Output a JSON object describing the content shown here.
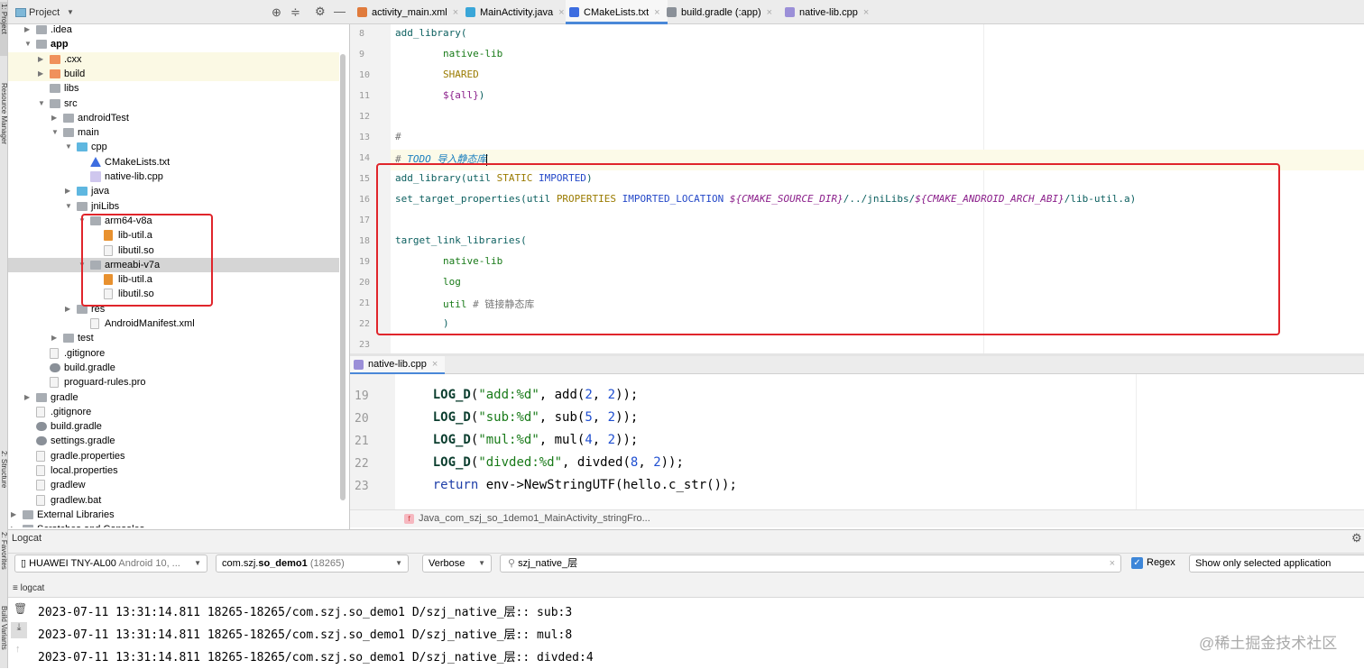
{
  "side_strip": {
    "top_label": "1: Project",
    "mid_label": "Resource Manager",
    "low_label": "2: Structure",
    "fav_label": "2: Favorites",
    "bottom_label": "Build Variants"
  },
  "project": {
    "title": "Project",
    "tree": [
      {
        "label": ".idea",
        "level": 0,
        "arrow": "closed",
        "icon": "folder"
      },
      {
        "label": "app",
        "level": 0,
        "arrow": "open",
        "icon": "folder",
        "bold": true
      },
      {
        "label": ".cxx",
        "level": 1,
        "arrow": "closed",
        "icon": "orange",
        "hl": true
      },
      {
        "label": "build",
        "level": 1,
        "arrow": "closed",
        "icon": "orange",
        "hl": true
      },
      {
        "label": "libs",
        "level": 1,
        "arrow": "",
        "icon": "folder"
      },
      {
        "label": "src",
        "level": 1,
        "arrow": "open",
        "icon": "folder"
      },
      {
        "label": "androidTest",
        "level": 2,
        "arrow": "closed",
        "icon": "folder"
      },
      {
        "label": "main",
        "level": 2,
        "arrow": "open",
        "icon": "folder"
      },
      {
        "label": "cpp",
        "level": 3,
        "arrow": "open",
        "icon": "blue"
      },
      {
        "label": "CMakeLists.txt",
        "level": 4,
        "arrow": "",
        "icon": "cmake"
      },
      {
        "label": "native-lib.cpp",
        "level": 4,
        "arrow": "",
        "icon": "cpp"
      },
      {
        "label": "java",
        "level": 3,
        "arrow": "closed",
        "icon": "blue"
      },
      {
        "label": "jniLibs",
        "level": 3,
        "arrow": "open",
        "icon": "folder"
      },
      {
        "label": "arm64-v8a",
        "level": 4,
        "arrow": "open",
        "icon": "folder"
      },
      {
        "label": "lib-util.a",
        "level": 5,
        "arrow": "",
        "icon": "archive"
      },
      {
        "label": "libutil.so",
        "level": 5,
        "arrow": "",
        "icon": "file"
      },
      {
        "label": "armeabi-v7a",
        "level": 4,
        "arrow": "open",
        "icon": "folder",
        "selected": true
      },
      {
        "label": "lib-util.a",
        "level": 5,
        "arrow": "",
        "icon": "archive"
      },
      {
        "label": "libutil.so",
        "level": 5,
        "arrow": "",
        "icon": "file"
      },
      {
        "label": "res",
        "level": 3,
        "arrow": "closed",
        "icon": "folder"
      },
      {
        "label": "AndroidManifest.xml",
        "level": 4,
        "arrow": "",
        "icon": "file"
      },
      {
        "label": "test",
        "level": 2,
        "arrow": "closed",
        "icon": "folder"
      },
      {
        "label": ".gitignore",
        "level": 1,
        "arrow": "",
        "icon": "file"
      },
      {
        "label": "build.gradle",
        "level": 1,
        "arrow": "",
        "icon": "gradle"
      },
      {
        "label": "proguard-rules.pro",
        "level": 1,
        "arrow": "",
        "icon": "file"
      },
      {
        "label": "gradle",
        "level": 0,
        "arrow": "closed",
        "icon": "folder"
      },
      {
        "label": ".gitignore",
        "level": 0,
        "arrow": "",
        "icon": "file"
      },
      {
        "label": "build.gradle",
        "level": 0,
        "arrow": "",
        "icon": "gradle"
      },
      {
        "label": "settings.gradle",
        "level": 0,
        "arrow": "",
        "icon": "gradle"
      },
      {
        "label": "gradle.properties",
        "level": 0,
        "arrow": "",
        "icon": "file"
      },
      {
        "label": "local.properties",
        "level": 0,
        "arrow": "",
        "icon": "file"
      },
      {
        "label": "gradlew",
        "level": 0,
        "arrow": "",
        "icon": "file"
      },
      {
        "label": "gradlew.bat",
        "level": 0,
        "arrow": "",
        "icon": "file"
      },
      {
        "label": "External Libraries",
        "level": -1,
        "arrow": "closed",
        "icon": "folder"
      },
      {
        "label": "Scratches and Consoles",
        "level": -1,
        "arrow": "closed",
        "icon": "folder"
      }
    ]
  },
  "editor_tabs": [
    {
      "label": "activity_main.xml",
      "color": "#e07b3c"
    },
    {
      "label": "MainActivity.java",
      "color": "#3aa6d8"
    },
    {
      "label": "CMakeLists.txt",
      "color": "#3d6de0",
      "active": true
    },
    {
      "label": "build.gradle (:app)",
      "color": "#8a9098"
    },
    {
      "label": "native-lib.cpp",
      "color": "#9b8fd8"
    }
  ],
  "cmake_lines": [
    {
      "n": "8",
      "t": [
        [
          "add_library(",
          "kw"
        ]
      ]
    },
    {
      "n": "9",
      "t": [
        [
          "        native-lib",
          "str"
        ]
      ]
    },
    {
      "n": "10",
      "t": [
        [
          "        SHARED",
          "con"
        ]
      ]
    },
    {
      "n": "11",
      "t": [
        [
          "        ${all}",
          "var"
        ],
        [
          ")",
          "kw"
        ]
      ]
    },
    {
      "n": "12",
      "t": []
    },
    {
      "n": "13",
      "t": [
        [
          "#",
          "cm"
        ]
      ]
    },
    {
      "n": "14",
      "t": [
        [
          "# ",
          "cm"
        ],
        [
          "TODO 导入静态库",
          "todo"
        ]
      ],
      "cur": true
    },
    {
      "n": "15",
      "t": [
        [
          "add_library(util ",
          "kw"
        ],
        [
          "STATIC ",
          "con"
        ],
        [
          "IMPORTED",
          "prop"
        ],
        [
          ")",
          "kw"
        ]
      ]
    },
    {
      "n": "16",
      "t": [
        [
          "set_target_properties(util ",
          "kw"
        ],
        [
          "PROPERTIES ",
          "con"
        ],
        [
          "IMPORTED_LOCATION ",
          "prop"
        ],
        [
          "${CMAKE_SOURCE_DIR}",
          "it"
        ],
        [
          "/../jniLibs/",
          "kw"
        ],
        [
          "${CMAKE_ANDROID_ARCH_ABI}",
          "it"
        ],
        [
          "/lib-util.a)",
          "kw"
        ]
      ]
    },
    {
      "n": "17",
      "t": []
    },
    {
      "n": "18",
      "t": [
        [
          "target_link_libraries(",
          "kw"
        ]
      ]
    },
    {
      "n": "19",
      "t": [
        [
          "        native-lib",
          "str"
        ]
      ]
    },
    {
      "n": "20",
      "t": [
        [
          "        log",
          "str"
        ]
      ]
    },
    {
      "n": "21",
      "t": [
        [
          "        util ",
          "str"
        ],
        [
          "# 链接静态库",
          "cm"
        ]
      ]
    },
    {
      "n": "22",
      "t": [
        [
          "        )",
          "kw"
        ]
      ]
    },
    {
      "n": "23",
      "t": []
    }
  ],
  "bottom_tab": "native-lib.cpp",
  "cpp_lines": [
    {
      "n": "19",
      "t": [
        [
          "    "
        ],
        [
          "LOG_D",
          "fn"
        ],
        [
          "("
        ],
        [
          "\"add:%d\"",
          "str"
        ],
        [
          ", add("
        ],
        [
          "2",
          "num"
        ],
        [
          ", "
        ],
        [
          "2",
          "num"
        ],
        [
          "));"
        ]
      ]
    },
    {
      "n": "20",
      "t": [
        [
          "    "
        ],
        [
          "LOG_D",
          "fn"
        ],
        [
          "("
        ],
        [
          "\"sub:%d\"",
          "str"
        ],
        [
          ", sub("
        ],
        [
          "5",
          "num"
        ],
        [
          ", "
        ],
        [
          "2",
          "num"
        ],
        [
          "));"
        ]
      ]
    },
    {
      "n": "21",
      "t": [
        [
          "    "
        ],
        [
          "LOG_D",
          "fn"
        ],
        [
          "("
        ],
        [
          "\"mul:%d\"",
          "str"
        ],
        [
          ", mul("
        ],
        [
          "4",
          "num"
        ],
        [
          ", "
        ],
        [
          "2",
          "num"
        ],
        [
          "));"
        ]
      ]
    },
    {
      "n": "22",
      "t": [
        [
          "    "
        ],
        [
          "LOG_D",
          "fn"
        ],
        [
          "("
        ],
        [
          "\"divded:%d\"",
          "str"
        ],
        [
          ", divded("
        ],
        [
          "8",
          "num"
        ],
        [
          ", "
        ],
        [
          "2",
          "num"
        ],
        [
          "));"
        ]
      ]
    },
    {
      "n": "23",
      "t": [
        [
          "    "
        ],
        [
          "return",
          "ret"
        ],
        [
          " env->NewStringUTF(hello.c_str());"
        ]
      ]
    }
  ],
  "breadcrumb": "Java_com_szj_so_1demo1_MainActivity_stringFro...",
  "logcat": {
    "title": "Logcat",
    "device": "HUAWEI TNY-AL00",
    "device_sub": "Android 10, ...",
    "process_pre": "com.szj.",
    "process_bold": "so_demo1",
    "process_pid": "(18265)",
    "level": "Verbose",
    "search": "szj_native_层",
    "regex_label": "Regex",
    "regex_checked": true,
    "filter": "Show only selected application",
    "subtab": "logcat",
    "lines": [
      "2023-07-11 13:31:14.811 18265-18265/com.szj.so_demo1 D/szj_native_层:: sub:3",
      "2023-07-11 13:31:14.811 18265-18265/com.szj.so_demo1 D/szj_native_层:: mul:8",
      "2023-07-11 13:31:14.811 18265-18265/com.szj.so_demo1 D/szj_native_层:: divded:4"
    ]
  },
  "watermark": "@稀土掘金技术社区",
  "colors": {
    "highlight_box": "#e0252b",
    "tab_accent": "#4a88d8",
    "checkbox": "#3d86d8"
  }
}
